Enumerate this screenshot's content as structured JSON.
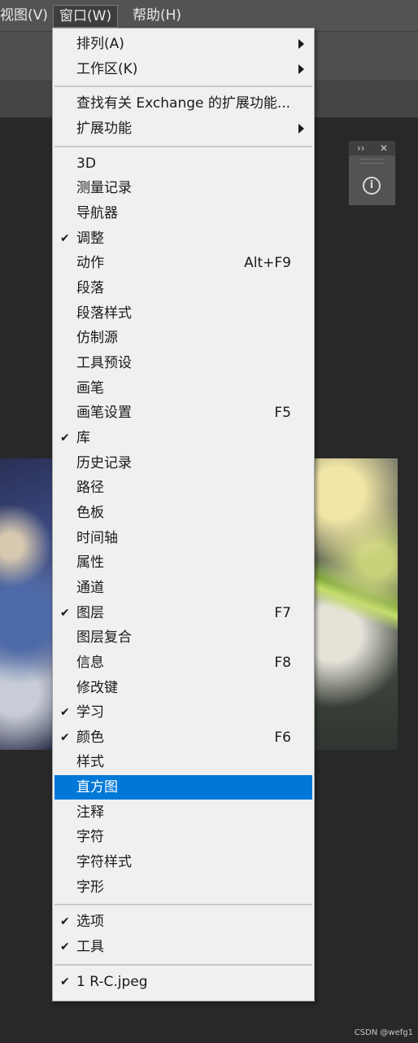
{
  "menubar": {
    "items": [
      {
        "label": "视图(V)"
      },
      {
        "label": "窗口(W)"
      },
      {
        "label": "帮助(H)"
      }
    ]
  },
  "mini_panel": {
    "expand_icon": "double-chevron-right-icon",
    "close_icon": "close-icon",
    "info_icon": "info-icon"
  },
  "window_menu": {
    "groups": [
      [
        {
          "label": "排列(A)",
          "submenu": true
        },
        {
          "label": "工作区(K)",
          "submenu": true
        }
      ],
      [
        {
          "label": "查找有关 Exchange 的扩展功能..."
        },
        {
          "label": "扩展功能",
          "submenu": true
        }
      ],
      [
        {
          "label": "3D"
        },
        {
          "label": "测量记录"
        },
        {
          "label": "导航器"
        },
        {
          "label": "调整",
          "checked": true
        },
        {
          "label": "动作",
          "shortcut": "Alt+F9"
        },
        {
          "label": "段落"
        },
        {
          "label": "段落样式"
        },
        {
          "label": "仿制源"
        },
        {
          "label": "工具预设"
        },
        {
          "label": "画笔"
        },
        {
          "label": "画笔设置",
          "shortcut": "F5"
        },
        {
          "label": "库",
          "checked": true
        },
        {
          "label": "历史记录"
        },
        {
          "label": "路径"
        },
        {
          "label": "色板"
        },
        {
          "label": "时间轴"
        },
        {
          "label": "属性"
        },
        {
          "label": "通道"
        },
        {
          "label": "图层",
          "checked": true,
          "shortcut": "F7"
        },
        {
          "label": "图层复合"
        },
        {
          "label": "信息",
          "shortcut": "F8"
        },
        {
          "label": "修改键"
        },
        {
          "label": "学习",
          "checked": true
        },
        {
          "label": "颜色",
          "checked": true,
          "shortcut": "F6"
        },
        {
          "label": "样式"
        },
        {
          "label": "直方图",
          "highlighted": true
        },
        {
          "label": "注释"
        },
        {
          "label": "字符"
        },
        {
          "label": "字符样式"
        },
        {
          "label": "字形"
        }
      ],
      [
        {
          "label": "选项",
          "checked": true
        },
        {
          "label": "工具",
          "checked": true
        }
      ],
      [
        {
          "label": "1 R-C.jpeg",
          "checked": true
        }
      ]
    ],
    "highlight_color": "#0078d7"
  },
  "watermark": {
    "text": "CSDN @wefg1"
  }
}
